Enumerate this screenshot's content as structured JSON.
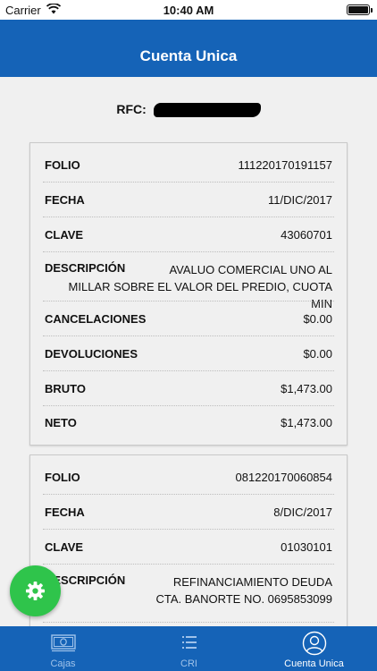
{
  "status_bar": {
    "carrier": "Carrier",
    "time": "10:40 AM"
  },
  "nav": {
    "title": "Cuenta Unica"
  },
  "rfc": {
    "label": "RFC:"
  },
  "records": [
    {
      "folio_label": "FOLIO",
      "folio": "111220170191157",
      "fecha_label": "FECHA",
      "fecha": "11/DIC/2017",
      "clave_label": "CLAVE",
      "clave": "43060701",
      "descripcion_label": "DESCRIPCIÓN",
      "descripcion": "AVALUO COMERCIAL UNO AL MILLAR SOBRE EL VALOR DEL PREDIO, CUOTA MIN",
      "cancelaciones_label": "CANCELACIONES",
      "cancelaciones": "$0.00",
      "devoluciones_label": "DEVOLUCIONES",
      "devoluciones": "$0.00",
      "bruto_label": "BRUTO",
      "bruto": "$1,473.00",
      "neto_label": "NETO",
      "neto": "$1,473.00"
    },
    {
      "folio_label": "FOLIO",
      "folio": "081220170060854",
      "fecha_label": "FECHA",
      "fecha": "8/DIC/2017",
      "clave_label": "CLAVE",
      "clave": "01030101",
      "descripcion_label": "DESCRIPCIÓN",
      "descripcion": "REFINANCIAMIENTO DEUDA CTA. BANORTE NO. 0695853099"
    }
  ],
  "tabs": [
    {
      "label": "Cajas",
      "icon": "cash-icon",
      "active": false
    },
    {
      "label": "CRI",
      "icon": "list-icon",
      "active": false
    },
    {
      "label": "Cuenta Unica",
      "icon": "user-icon",
      "active": true
    }
  ],
  "colors": {
    "primary": "#1563b7",
    "fab": "#2fc44b",
    "tab_inactive": "#9fc2ea"
  }
}
